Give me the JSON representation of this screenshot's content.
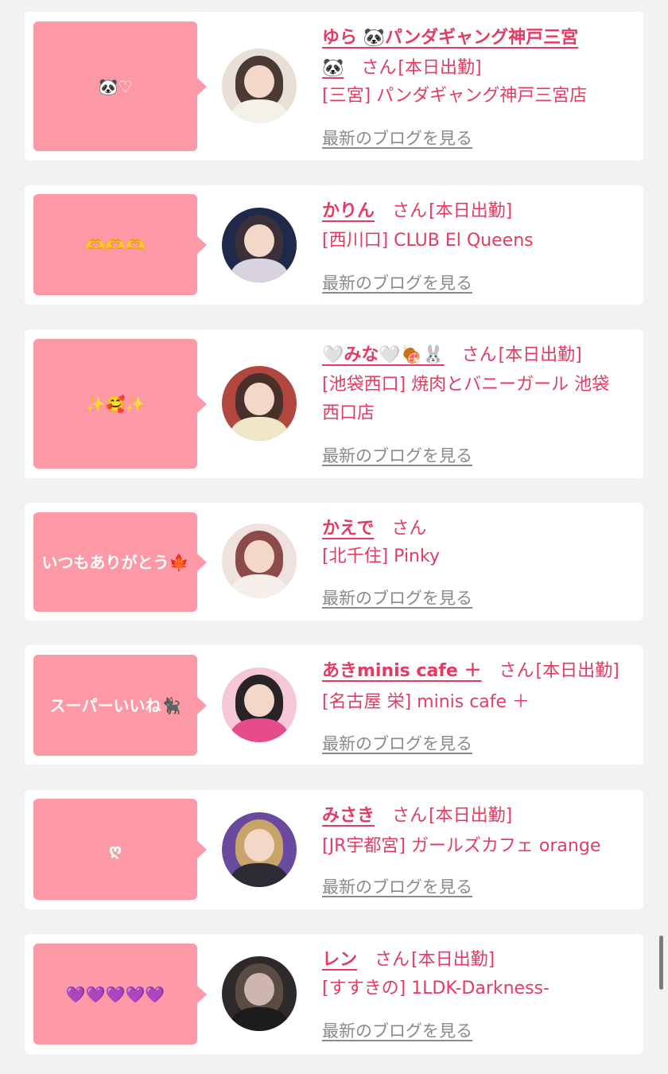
{
  "blog_link_label": "最新のブログを見る",
  "san_label": "さん",
  "status_today": "[本日出勤]",
  "cards": [
    {
      "bubble": "🐼♡",
      "name": "ゆら 🐼パンダギャング神戸三宮",
      "name2": "🐼",
      "location": "[三宮] パンダギャング神戸三宮店",
      "status": "[本日出勤]"
    },
    {
      "bubble": "🫶🫶🫶",
      "name": "かりん",
      "location": "[西川口] CLUB El Queens",
      "status": "[本日出勤]"
    },
    {
      "bubble": "✨🥰✨",
      "name": "🤍みな🤍🍖🐰",
      "location": "[池袋西口] 焼肉とバニーガール 池袋西口店",
      "status": "[本日出勤]"
    },
    {
      "bubble": "いつもありがとう🍁",
      "name": "かえで",
      "location": "[北千住] Pinky",
      "status": ""
    },
    {
      "bubble": "スーパーいいね🐈‍⬛",
      "name": "あきminis cafe ＋",
      "location": "[名古屋 栄] minis cafe ＋",
      "status": "[本日出勤]"
    },
    {
      "bubble": "ღ",
      "name": "みさき",
      "location": "[JR宇都宮] ガールズカフェ orange",
      "status": "[本日出勤]"
    },
    {
      "bubble": "💜💜💜💜💜",
      "name": "レン",
      "location": "[すすきの] 1LDK-Darkness-",
      "status": "[本日出勤]"
    }
  ]
}
